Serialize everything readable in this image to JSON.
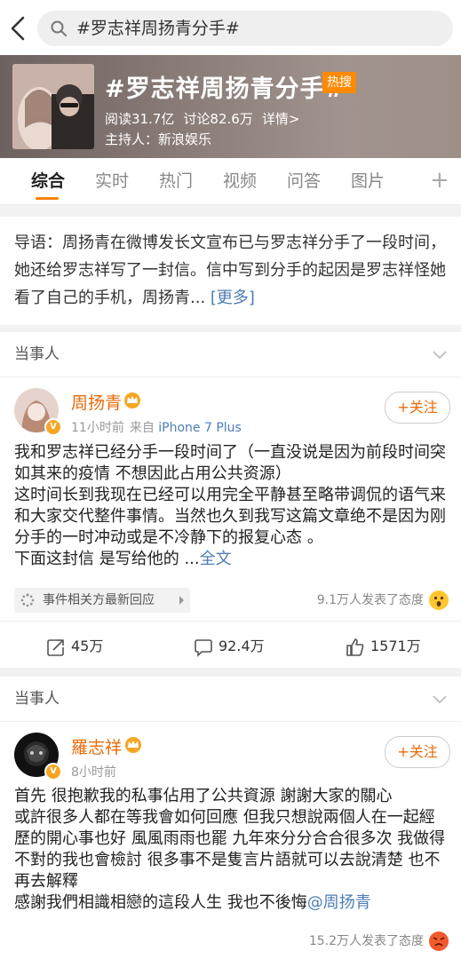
{
  "search": {
    "query": "#罗志祥周扬青分手#"
  },
  "topic": {
    "title": "#罗志祥周扬青分手#",
    "hot_badge": "热搜",
    "reads": "阅读31.7亿",
    "discussions": "讨论82.6万",
    "details": "详情>",
    "host": "主持人：新浪娱乐"
  },
  "tabs": [
    {
      "label": "综合"
    },
    {
      "label": "实时"
    },
    {
      "label": "热门"
    },
    {
      "label": "视频"
    },
    {
      "label": "问答"
    },
    {
      "label": "图片"
    }
  ],
  "tab_plus": "+",
  "intro": {
    "text": "导语：周扬青在微博发长文宣布已与罗志祥分手了一段时间，她还给罗志祥写了一封信。信中写到分手的起因是罗志祥怪她看了自己的手机，周扬青... ",
    "more": "[更多]"
  },
  "section_label": "当事人",
  "posts": [
    {
      "user": "周扬青",
      "time": "11小时前",
      "source_prefix": "来自",
      "source": "iPhone 7 Plus",
      "follow": "+关注",
      "body": [
        "我和罗志祥已经分手一段时间了（一直没说是因为前段时间突如其来的疫情 不想因此占用公共资源）",
        "这时间长到我现在已经可以用完全平静甚至略带调侃的语气来和大家交代整件事情。当然也久到我写这篇文章绝不是因为刚分手的一时冲动或是不冷静下的报复心态 。"
      ],
      "last_line": "下面这封信 是写给他的 ...",
      "full_text": "全文",
      "event_link": "事件相关方最新回应",
      "attitude": "9.1万人发表了态度",
      "reposts": "45万",
      "comments": "92.4万",
      "likes": "1571万"
    },
    {
      "user": "羅志祥",
      "time": "8小时前",
      "follow": "+关注",
      "body": [
        "首先 很抱歉我的私事佔用了公共資源 謝謝大家的關心",
        "或許很多人都在等我會如何回應 但我只想說兩個人在一起經歷的開心事也好 風風雨雨也罷 九年來分分合合很多次 我做得不對的我也會檢討 很多事不是隻言片語就可以去說清楚 也不再去解釋"
      ],
      "last_line": "感謝我們相識相戀的這段人生 我也不後悔",
      "mention": "@周扬青",
      "attitude": "15.2万人发表了态度"
    }
  ],
  "colors": {
    "brand_orange": "#ff8200",
    "username_orange": "#e86b0a",
    "link_blue": "#4e7db5",
    "hot_badge": "#ff8a00"
  }
}
